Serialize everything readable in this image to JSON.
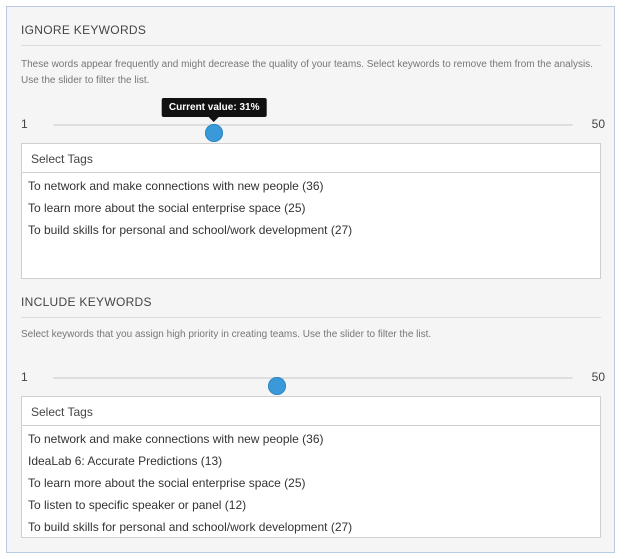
{
  "ignore": {
    "title": "IGNORE KEYWORDS",
    "description": "These words appear frequently and might decrease the quality of your teams. Select keywords to remove them from the analysis. Use the slider to filter the list.",
    "slider": {
      "min_label": "1",
      "max_label": "50",
      "value_percent": 31,
      "tooltip": "Current value: 31%"
    },
    "select_label": "Select Tags",
    "tags": [
      "To network and make connections with new people (36)",
      "To learn more about the social enterprise space (25)",
      "To build skills for personal and school/work development (27)"
    ]
  },
  "include": {
    "title": "INCLUDE KEYWORDS",
    "description": "Select keywords that you assign high priority in creating teams. Use the slider to filter the list.",
    "slider": {
      "min_label": "1",
      "max_label": "50",
      "value_percent": 43
    },
    "select_label": "Select Tags",
    "tags": [
      "To network and make connections with new people (36)",
      "IdeaLab 6: Accurate Predictions (13)",
      "To learn more about the social enterprise space (25)",
      "To listen to specific speaker or panel (12)",
      "To build skills for personal and school/work development (27)"
    ]
  },
  "colors": {
    "accent": "#3a9ad9",
    "panel_border": "#b9cbe2",
    "tooltip_bg": "#111111"
  }
}
